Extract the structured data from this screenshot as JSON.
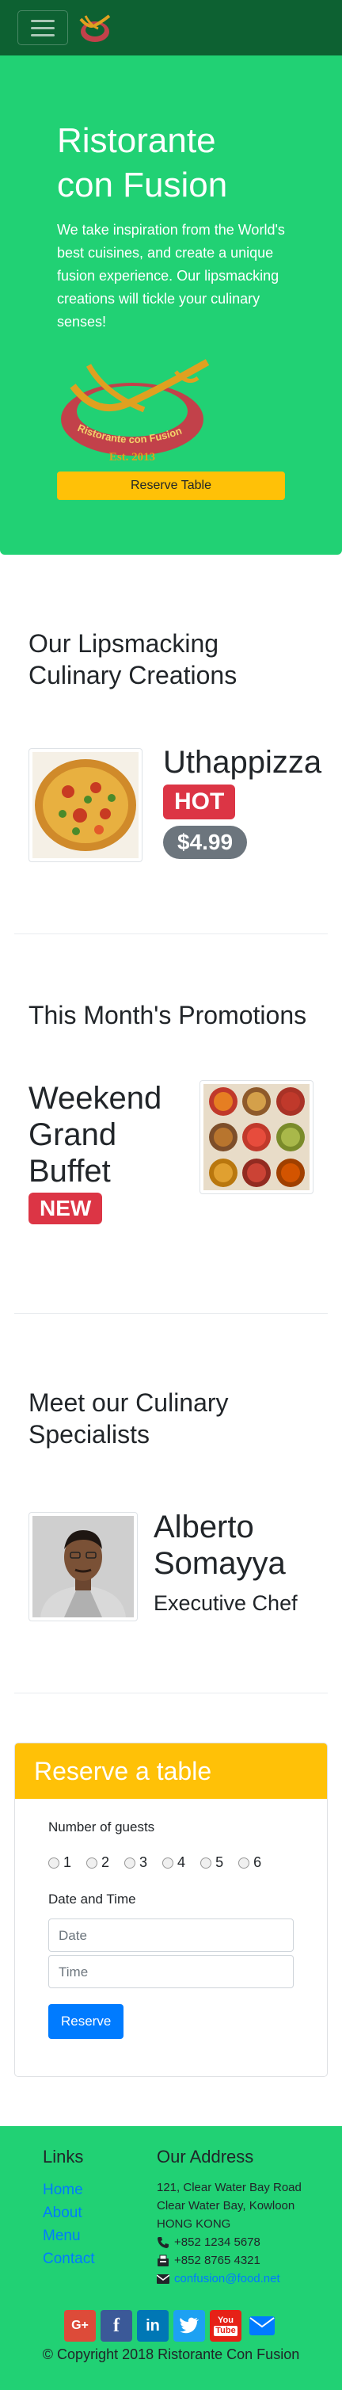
{
  "navbar": {
    "toggler_icon": "hamburger-icon",
    "logo_icon": "restaurant-logo-icon"
  },
  "jumbotron": {
    "title_line1": "Ristorante",
    "title_line2": "con Fusion",
    "description": "We take inspiration from the World's best cuisines, and create a unique fusion experience. Our lipsmacking creations will tickle your culinary senses!",
    "logo_text": "Ristorante con Fusion",
    "logo_est": "Est. 2013",
    "reserve_button": "Reserve Table"
  },
  "dish": {
    "section_title": "Our Lipsmacking Culinary Creations",
    "name": "Uthappizza",
    "badge": "HOT",
    "price": "$4.99"
  },
  "promotion": {
    "section_title": "This Month's Promotions",
    "name": "Weekend Grand Buffet",
    "badge": "NEW"
  },
  "leader": {
    "section_title": "Meet our Culinary Specialists",
    "name": "Alberto Somayya",
    "designation": "Executive Chef"
  },
  "reserve": {
    "header": "Reserve a table",
    "guests_label": "Number of guests",
    "guest_options": [
      "1",
      "2",
      "3",
      "4",
      "5",
      "6"
    ],
    "datetime_label": "Date and Time",
    "date_placeholder": "Date",
    "time_placeholder": "Time",
    "submit_button": "Reserve"
  },
  "footer": {
    "links_title": "Links",
    "links": [
      "Home",
      "About",
      "Menu",
      "Contact"
    ],
    "address_title": "Our Address",
    "address_line1": "121, Clear Water Bay Road",
    "address_line2": "Clear Water Bay, Kowloon",
    "address_line3": "HONG KONG",
    "phone": "+852 1234 5678",
    "fax": "+852 8765 4321",
    "email": "confusion@food.net",
    "social": [
      "google-plus-icon",
      "facebook-icon",
      "linkedin-icon",
      "twitter-icon",
      "youtube-icon",
      "email-icon"
    ],
    "copyright": "© Copyright 2018 Ristorante Con Fusion"
  },
  "colors": {
    "navbar": "#0d6132",
    "jumbotron": "#21d174",
    "warning": "#ffc107",
    "danger": "#dc3545",
    "primary": "#007bff"
  }
}
